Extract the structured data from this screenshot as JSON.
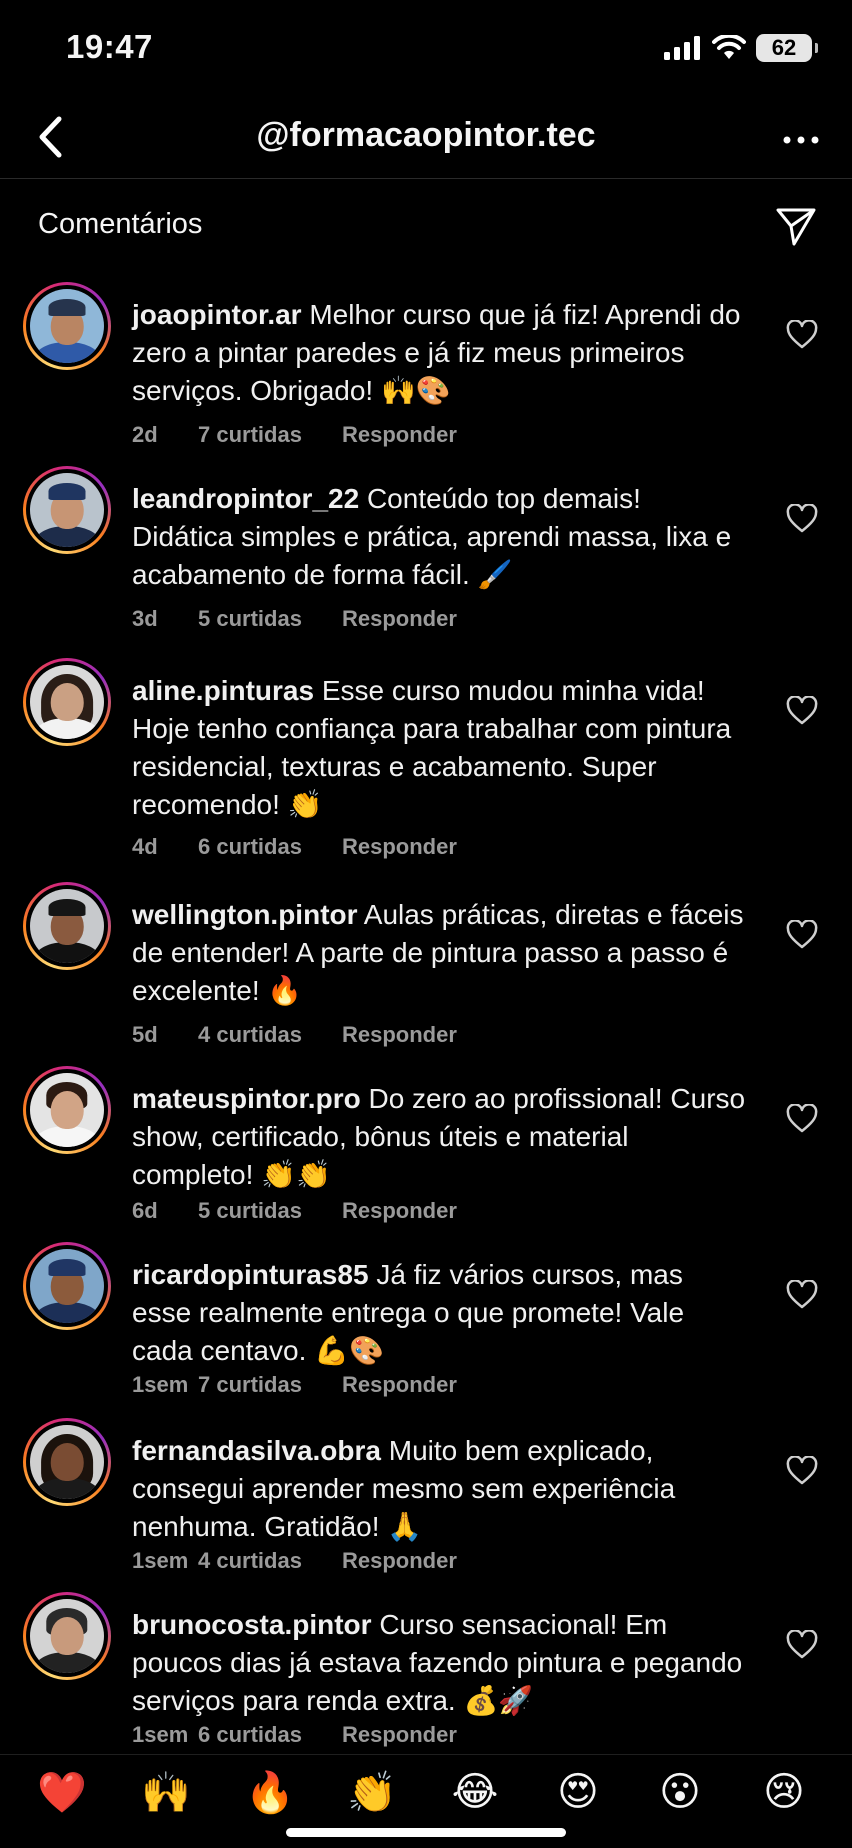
{
  "status_bar": {
    "time": "19:47",
    "battery": "62"
  },
  "header": {
    "title": "@formacaopintor.tec"
  },
  "section": {
    "title": "Comentários"
  },
  "comments": [
    {
      "username": "joaopintor.ar",
      "text": "Melhor curso que já fiz! Aprendi do zero a pintar paredes e já fiz meus primeiros serviços. Obrigado! 🙌🎨",
      "age": "2d",
      "likes": "7 curtidas",
      "reply": "Responder"
    },
    {
      "username": "leandropintor_22",
      "text": "Conteúdo top demais! Didática simples e prática, aprendi massa, lixa e acabamento de forma fácil. 🖌️",
      "age": "3d",
      "likes": "5 curtidas",
      "reply": "Responder"
    },
    {
      "username": "aline.pinturas",
      "text": "Esse curso mudou minha vida! Hoje tenho confiança para trabalhar com pintura residencial, texturas e acabamento. Super recomendo! 👏",
      "age": "4d",
      "likes": "6 curtidas",
      "reply": "Responder"
    },
    {
      "username": "wellington.pintor",
      "text": "Aulas práticas, diretas e fáceis de entender! A parte de pintura passo a passo é excelente! 🔥",
      "age": "5d",
      "likes": "4 curtidas",
      "reply": "Responder"
    },
    {
      "username": "mateuspintor.pro",
      "text": "Do zero ao profissional! Curso show, certificado, bônus úteis e material completo! 👏👏",
      "age": "6d",
      "likes": "5 curtidas",
      "reply": "Responder"
    },
    {
      "username": "ricardopinturas85",
      "text": "Já fiz vários cursos, mas esse realmente entrega o que promete! Vale cada centavo. 💪🎨",
      "age": "1sem",
      "likes": "7 curtidas",
      "reply": "Responder"
    },
    {
      "username": "fernandasilva.obra",
      "text": "Muito bem explicado, consegui aprender mesmo sem experiência nenhuma. Gratidão! 🙏",
      "age": "1sem",
      "likes": "4 curtidas",
      "reply": "Responder"
    },
    {
      "username": "brunocosta.pintor",
      "text": "Curso sensacional! Em poucos dias já estava fazendo pintura e pegando serviços para renda extra. 💰🚀",
      "age": "1sem",
      "likes": "6 curtidas",
      "reply": "Responder"
    }
  ],
  "emoji_bar": [
    "❤️",
    "🙌",
    "🔥",
    "👏",
    "😂",
    "😍",
    "😮",
    "😢"
  ]
}
